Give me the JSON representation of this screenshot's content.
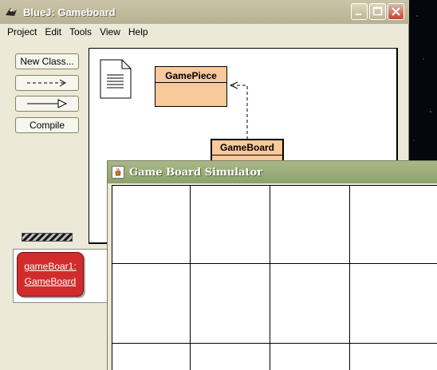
{
  "bluej": {
    "title": "BlueJ:  Gameboard",
    "menu": [
      "Project",
      "Edit",
      "Tools",
      "View",
      "Help"
    ],
    "buttons": {
      "new_class": "New Class...",
      "compile": "Compile"
    },
    "classes": {
      "gamepiece": "GamePiece",
      "gameboard": "GameBoard"
    },
    "object_bench": {
      "instance_line1": "gameBoar1:",
      "instance_line2": "GameBoard"
    }
  },
  "simulator": {
    "title": "Game Board Simulator"
  },
  "icons": {
    "bluej_app": "bluej-bird-icon",
    "java_app": "java-cup-icon",
    "readme": "document-icon",
    "minimize": "minimize-icon",
    "maximize": "maximize-icon",
    "close": "close-icon",
    "dashed_arrow": "uses-arrow-icon",
    "inherit_arrow": "inheritance-arrow-icon"
  },
  "colors": {
    "class_fill": "#f7c99b",
    "object_fill": "#d22b2b",
    "close_button": "#c8432b"
  }
}
